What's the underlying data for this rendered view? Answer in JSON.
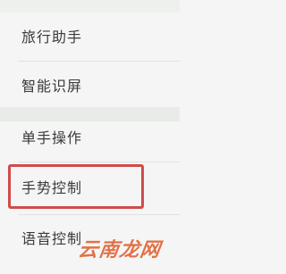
{
  "menu": {
    "items": [
      {
        "label": "旅行助手"
      },
      {
        "label": "智能识屏"
      },
      {
        "label": "单手操作"
      },
      {
        "label": "手势控制"
      },
      {
        "label": "语音控制"
      }
    ],
    "highlighted_index": 3
  },
  "watermark": {
    "text": "云南龙网"
  },
  "colors": {
    "background": "#f4f5f4",
    "text": "#3a3a3a",
    "highlight": "#d14b4b",
    "watermark": "#e05a2a"
  }
}
